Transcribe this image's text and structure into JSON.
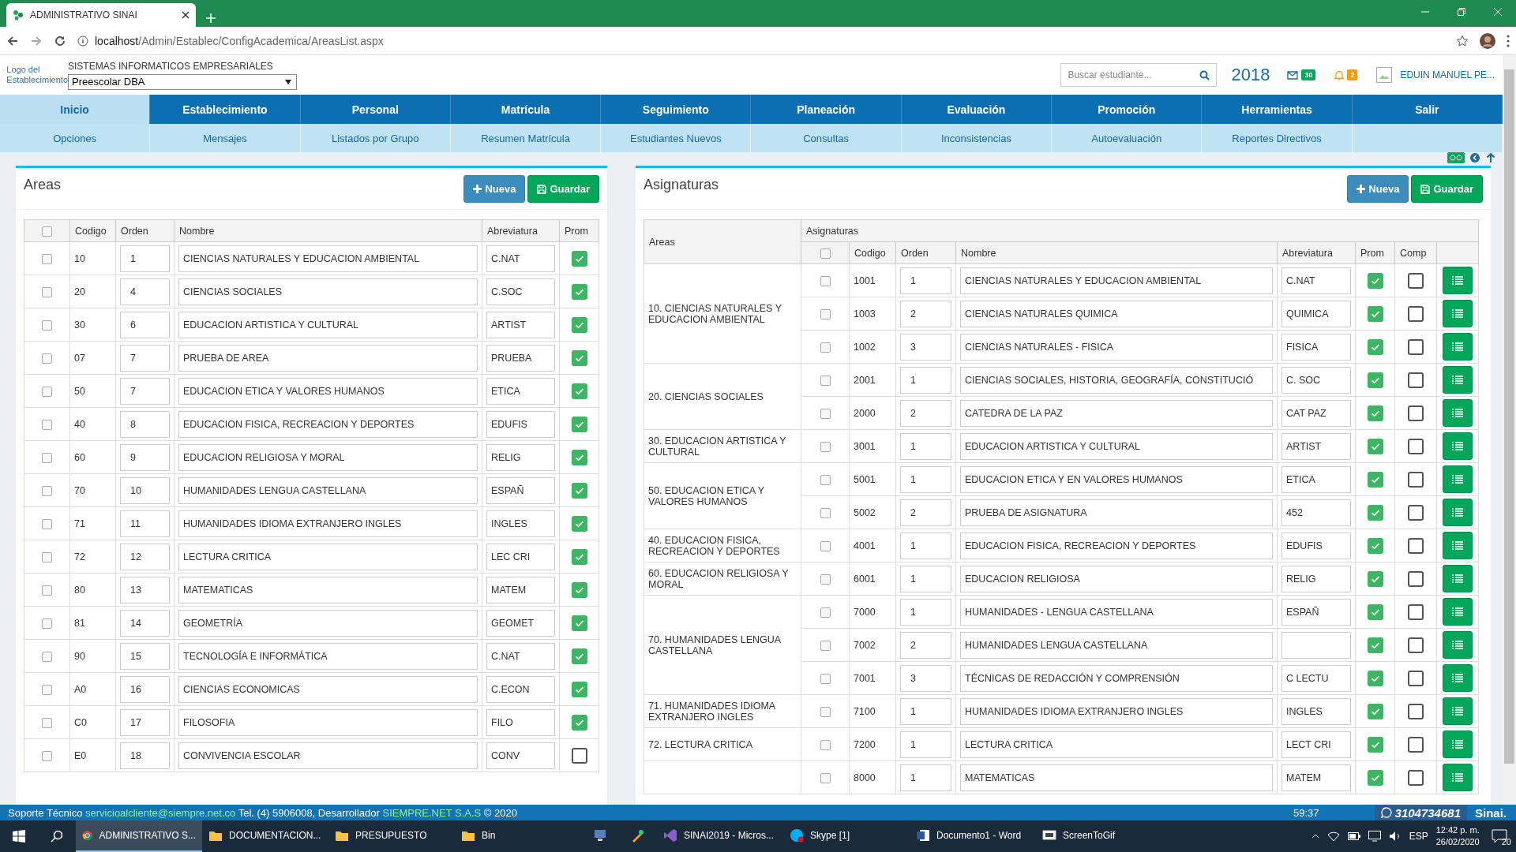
{
  "browser": {
    "tab_title": "ADMINISTRATIVO SINAI",
    "url_host": "localhost",
    "url_path": "/Admin/Establec/ConfigAcademica/AreasList.aspx"
  },
  "header": {
    "logo_alt": "Logo del Establecimiento",
    "company": "SISTEMAS INFORMATICOS EMPRESARIALES",
    "program": "Preescolar DBA",
    "search": {
      "placeholder": "Buscar estudiante..."
    },
    "year": "2018",
    "messages": "30",
    "alerts": "2",
    "user": "EDUIN MANUEL PE..."
  },
  "menu": [
    {
      "label": "Inicio",
      "selected": true
    },
    {
      "label": "Establecimiento",
      "selected": false
    },
    {
      "label": "Personal",
      "selected": false
    },
    {
      "label": "Matrícula",
      "selected": false
    },
    {
      "label": "Seguimiento",
      "selected": false
    },
    {
      "label": "Planeación",
      "selected": false
    },
    {
      "label": "Evaluación",
      "selected": false
    },
    {
      "label": "Promoción",
      "selected": false
    },
    {
      "label": "Herramientas",
      "selected": false
    },
    {
      "label": "Salir",
      "selected": false
    }
  ],
  "submenu": [
    "Opciones",
    "Mensajes",
    "Listados por Grupo",
    "Resumen Matrícula",
    "Estudiantes Nuevos",
    "Consultas",
    "Inconsistencias",
    "Autoevaluación",
    "Reportes Directivos"
  ],
  "areas_panel": {
    "title": "Areas",
    "buttons": [
      "Nueva",
      "Guardar"
    ],
    "columns": [
      "Codigo",
      "Orden",
      "Nombre",
      "Abreviatura",
      "Prom"
    ],
    "header_checked": false,
    "rows": [
      {
        "checked": false,
        "codigo": "10",
        "orden": "1",
        "nombre": "CIENCIAS NATURALES Y EDUCACION AMBIENTAL",
        "abreviatura": "C.NAT",
        "prom": true
      },
      {
        "checked": false,
        "codigo": "20",
        "orden": "4",
        "nombre": "CIENCIAS SOCIALES",
        "abreviatura": "C.SOC",
        "prom": true
      },
      {
        "checked": false,
        "codigo": "30",
        "orden": "6",
        "nombre": "EDUCACION ARTISTICA Y CULTURAL",
        "abreviatura": "ARTIST",
        "prom": true
      },
      {
        "checked": false,
        "codigo": "07",
        "orden": "7",
        "nombre": "PRUEBA DE AREA",
        "abreviatura": "PRUEBA",
        "prom": true
      },
      {
        "checked": false,
        "codigo": "50",
        "orden": "7",
        "nombre": "EDUCACION ETICA Y VALORES HUMANOS",
        "abreviatura": "ETICA",
        "prom": true
      },
      {
        "checked": false,
        "codigo": "40",
        "orden": "8",
        "nombre": "EDUCACION FISICA, RECREACION Y DEPORTES",
        "abreviatura": "EDUFIS",
        "prom": true
      },
      {
        "checked": false,
        "codigo": "60",
        "orden": "9",
        "nombre": "EDUCACION RELIGIOSA Y MORAL",
        "abreviatura": "RELIG",
        "prom": true
      },
      {
        "checked": false,
        "codigo": "70",
        "orden": "10",
        "nombre": "HUMANIDADES LENGUA CASTELLANA",
        "abreviatura": "ESPAÑ",
        "prom": true
      },
      {
        "checked": false,
        "codigo": "71",
        "orden": "11",
        "nombre": "HUMANIDADES IDIOMA EXTRANJERO INGLES",
        "abreviatura": "INGLES",
        "prom": true
      },
      {
        "checked": false,
        "codigo": "72",
        "orden": "12",
        "nombre": "LECTURA CRITICA",
        "abreviatura": "LEC CRI",
        "prom": true
      },
      {
        "checked": false,
        "codigo": "80",
        "orden": "13",
        "nombre": "MATEMATICAS",
        "abreviatura": "MATEM",
        "prom": true
      },
      {
        "checked": false,
        "codigo": "81",
        "orden": "14",
        "nombre": "GEOMETRÍA",
        "abreviatura": "GEOMET",
        "prom": true
      },
      {
        "checked": false,
        "codigo": "90",
        "orden": "15",
        "nombre": "TECNOLOGÍA E INFORMÁTICA",
        "abreviatura": "C.NAT",
        "prom": true
      },
      {
        "checked": false,
        "codigo": "A0",
        "orden": "16",
        "nombre": "CIENCIAS ECONOMICAS",
        "abreviatura": "C.ECON",
        "prom": true
      },
      {
        "checked": false,
        "codigo": "C0",
        "orden": "17",
        "nombre": "FILOSOFIA",
        "abreviatura": "FILO",
        "prom": true
      },
      {
        "checked": false,
        "codigo": "E0",
        "orden": "18",
        "nombre": "CONVIVENCIA ESCOLAR",
        "abreviatura": "CONV",
        "prom": false
      }
    ]
  },
  "asignaturas_panel": {
    "title": "Asignaturas",
    "buttons": [
      "Nueva",
      "Guardar"
    ],
    "areas_header": "Areas",
    "group_header": "Asignaturas",
    "columns": [
      "Codigo",
      "Orden",
      "Nombre",
      "Abreviatura",
      "Prom",
      "Comp"
    ],
    "header_checked": false,
    "areas": [
      {
        "name": "10. CIENCIAS NATURALES Y EDUCACION AMBIENTAL",
        "subjects": [
          {
            "checked": false,
            "codigo": "1001",
            "orden": "1",
            "nombre": "CIENCIAS NATURALES Y EDUCACION AMBIENTAL",
            "abreviatura": "C.NAT",
            "prom": true,
            "comp": false
          },
          {
            "checked": false,
            "codigo": "1003",
            "orden": "2",
            "nombre": "CIENCIAS NATURALES QUIMICA",
            "abreviatura": "QUIMICA",
            "prom": true,
            "comp": false
          },
          {
            "checked": false,
            "codigo": "1002",
            "orden": "3",
            "nombre": "CIENCIAS NATURALES - FISICA",
            "abreviatura": "FISICA",
            "prom": true,
            "comp": false
          }
        ]
      },
      {
        "name": "20. CIENCIAS SOCIALES",
        "subjects": [
          {
            "checked": false,
            "codigo": "2001",
            "orden": "1",
            "nombre": "CIENCIAS SOCIALES, HISTORIA, GEOGRAFÍA, CONSTITUCIÓ",
            "abreviatura": "C. SOC",
            "prom": true,
            "comp": false
          },
          {
            "checked": false,
            "codigo": "2000",
            "orden": "2",
            "nombre": "CATEDRA DE LA PAZ",
            "abreviatura": "CAT PAZ",
            "prom": true,
            "comp": false
          }
        ]
      },
      {
        "name": "30. EDUCACION ARTISTICA Y CULTURAL",
        "subjects": [
          {
            "checked": false,
            "codigo": "3001",
            "orden": "1",
            "nombre": "EDUCACION ARTISTICA Y CULTURAL",
            "abreviatura": "ARTIST",
            "prom": true,
            "comp": false
          }
        ]
      },
      {
        "name": "50. EDUCACION ETICA Y VALORES HUMANOS",
        "subjects": [
          {
            "checked": false,
            "codigo": "5001",
            "orden": "1",
            "nombre": "EDUCACION ETICA Y EN VALORES HUMANOS",
            "abreviatura": "ETICA",
            "prom": true,
            "comp": false
          },
          {
            "checked": false,
            "codigo": "5002",
            "orden": "2",
            "nombre": "PRUEBA DE ASIGNATURA",
            "abreviatura": "452",
            "prom": true,
            "comp": false
          }
        ]
      },
      {
        "name": "40. EDUCACION FISICA, RECREACION Y DEPORTES",
        "subjects": [
          {
            "checked": false,
            "codigo": "4001",
            "orden": "1",
            "nombre": "EDUCACION FISICA, RECREACION Y DEPORTES",
            "abreviatura": "EDUFIS",
            "prom": true,
            "comp": false
          }
        ]
      },
      {
        "name": "60. EDUCACION RELIGIOSA Y MORAL",
        "subjects": [
          {
            "checked": false,
            "codigo": "6001",
            "orden": "1",
            "nombre": "EDUCACION RELIGIOSA",
            "abreviatura": "RELIG",
            "prom": true,
            "comp": false
          }
        ]
      },
      {
        "name": "70. HUMANIDADES LENGUA CASTELLANA",
        "subjects": [
          {
            "checked": false,
            "codigo": "7000",
            "orden": "1",
            "nombre": "HUMANIDADES - LENGUA CASTELLANA",
            "abreviatura": "ESPAÑ",
            "prom": true,
            "comp": false
          },
          {
            "checked": false,
            "codigo": "7002",
            "orden": "2",
            "nombre": "HUMANIDADES LENGUA CASTELLANA",
            "prom": true,
            "comp": false
          },
          {
            "checked": false,
            "codigo": "7001",
            "orden": "3",
            "nombre": "TÉCNICAS DE REDACCIÓN Y COMPRENSIÓN",
            "abreviatura": "C LECTU",
            "prom": true,
            "comp": false
          }
        ]
      },
      {
        "name": "71. HUMANIDADES IDIOMA EXTRANJERO INGLES",
        "subjects": [
          {
            "checked": false,
            "codigo": "7100",
            "orden": "1",
            "nombre": "HUMANIDADES IDIOMA EXTRANJERO INGLES",
            "abreviatura": "INGLES",
            "prom": true,
            "comp": false
          }
        ]
      },
      {
        "name": "72. LECTURA CRITICA",
        "subjects": [
          {
            "checked": false,
            "codigo": "7200",
            "orden": "1",
            "nombre": "LECTURA CRITICA",
            "abreviatura": "LECT CRI",
            "prom": true,
            "comp": false
          }
        ]
      },
      {
        "subjects": [
          {
            "checked": false,
            "codigo": "8000",
            "orden": "1",
            "nombre": "MATEMATICAS",
            "abreviatura": "MATEM",
            "prom": true,
            "comp": false
          }
        ]
      }
    ]
  },
  "status_bar": {
    "support_label": "Soporte Técnico",
    "email": "servicioalcliente@siempre.net.co",
    "contact": "Tel. (4) 5906008, Desarrollador",
    "developer": "SIEMPRE.NET S.A.S",
    "copyright": "© 2020",
    "timer": "59:37",
    "whatsapp": "3104734681",
    "brand": "Sinai."
  },
  "taskbar": {
    "apps": [
      {
        "kind": "browser",
        "label": "ADMINISTRATIVO S...",
        "selected": true
      },
      {
        "kind": "folder",
        "label": "DOCUMENTACION...",
        "selected": false
      },
      {
        "kind": "folder",
        "label": "PRESUPUESTO",
        "selected": false
      },
      {
        "kind": "folder",
        "label": "Bin",
        "selected": false
      },
      {
        "kind": "monitor",
        "selected": false
      },
      {
        "kind": "tool",
        "selected": false
      },
      {
        "kind": "editor",
        "label": "SINAI2019 - Micros...",
        "selected": false
      },
      {
        "kind": "chat",
        "label": "Skype [1]",
        "selected": false
      },
      {
        "kind": "document",
        "label": "Documento1 - Word",
        "selected": false
      },
      {
        "kind": "recorder",
        "label": "ScreenToGif",
        "selected": false
      }
    ],
    "language": "ESP",
    "time": "12:42 p. m.",
    "date": "26/02/2020",
    "notifications": "20"
  }
}
